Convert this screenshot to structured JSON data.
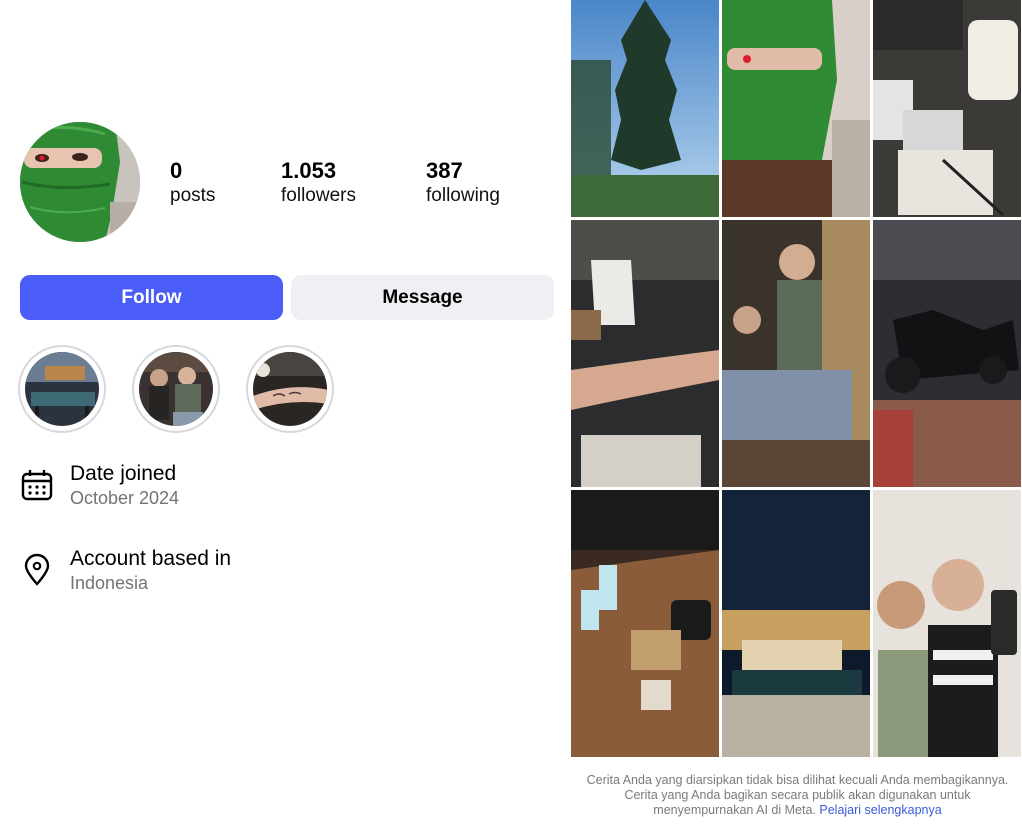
{
  "profile": {
    "avatar_icon": "green-balaclava-avatar",
    "stats": [
      {
        "value": "0",
        "label": "posts"
      },
      {
        "value": "1.053",
        "label": "followers"
      },
      {
        "value": "387",
        "label": "following"
      }
    ]
  },
  "actions": {
    "follow_label": "Follow",
    "message_label": "Message",
    "follow_color": "#4a5df9",
    "message_color": "#eff0f4"
  },
  "highlights": [
    {
      "icon": "billiard-hall-photo"
    },
    {
      "icon": "people-photo"
    },
    {
      "icon": "tattoo-arm-photo"
    }
  ],
  "about": {
    "date_joined_label": "Date joined",
    "date_joined_value": "October 2024",
    "location_label": "Account based in",
    "location_value": "Indonesia",
    "date_icon": "calendar-icon",
    "location_icon": "location-pin-icon"
  },
  "grid_icons": [
    "sky-tree-photo",
    "green-mask-selfie-photo",
    "kitchen-table-photo",
    "drinks-table-photo",
    "mirror-selfie-photo",
    "scooter-night-photo",
    "cafe-table-photo",
    "night-billiard-photo",
    "friends-selfie-photo"
  ],
  "footer": {
    "text": "Cerita Anda yang diarsipkan tidak bisa dilihat kecuali Anda membagikannya. Cerita yang Anda bagikan secara publik akan digunakan untuk menyempurnakan AI di Meta.",
    "link": "Pelajari selengkapnya"
  }
}
